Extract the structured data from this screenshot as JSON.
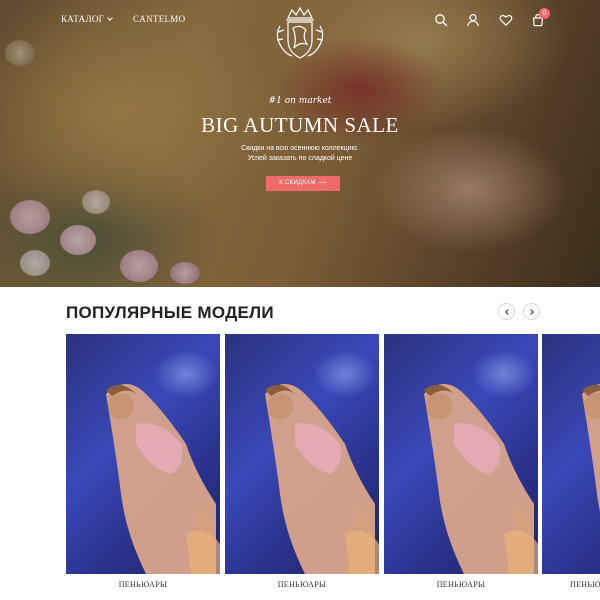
{
  "nav": {
    "catalog_label": "КАТАЛОГ",
    "brand_link": "CANTELMO",
    "logo_text": "CANTELMO",
    "cart_count": "0"
  },
  "hero": {
    "tagline": "#1 on market",
    "title": "BIG AUTUMN SALE",
    "subtitle_line1": "Скидки на всю осеннюю коллекцию.",
    "subtitle_line2": "Успей заказать по сладкой цене",
    "cta_label": "К СКИДКАМ ⟶"
  },
  "popular": {
    "title": "ПОПУЛЯРНЫЕ МОДЕЛИ",
    "products": [
      {
        "label": "ПЕНЬЮАРЫ"
      },
      {
        "label": "ПЕНЬЮАРЫ"
      },
      {
        "label": "ПЕНЬЮАРЫ"
      },
      {
        "label": "ПЕНЬЮАРЫ"
      }
    ]
  },
  "colors": {
    "accent": "#f06a6a",
    "product_bg": "#2f3a9e"
  },
  "icons": [
    "search-icon",
    "user-icon",
    "heart-icon",
    "cart-icon",
    "chevron-down-icon",
    "chevron-left-icon",
    "chevron-right-icon"
  ]
}
